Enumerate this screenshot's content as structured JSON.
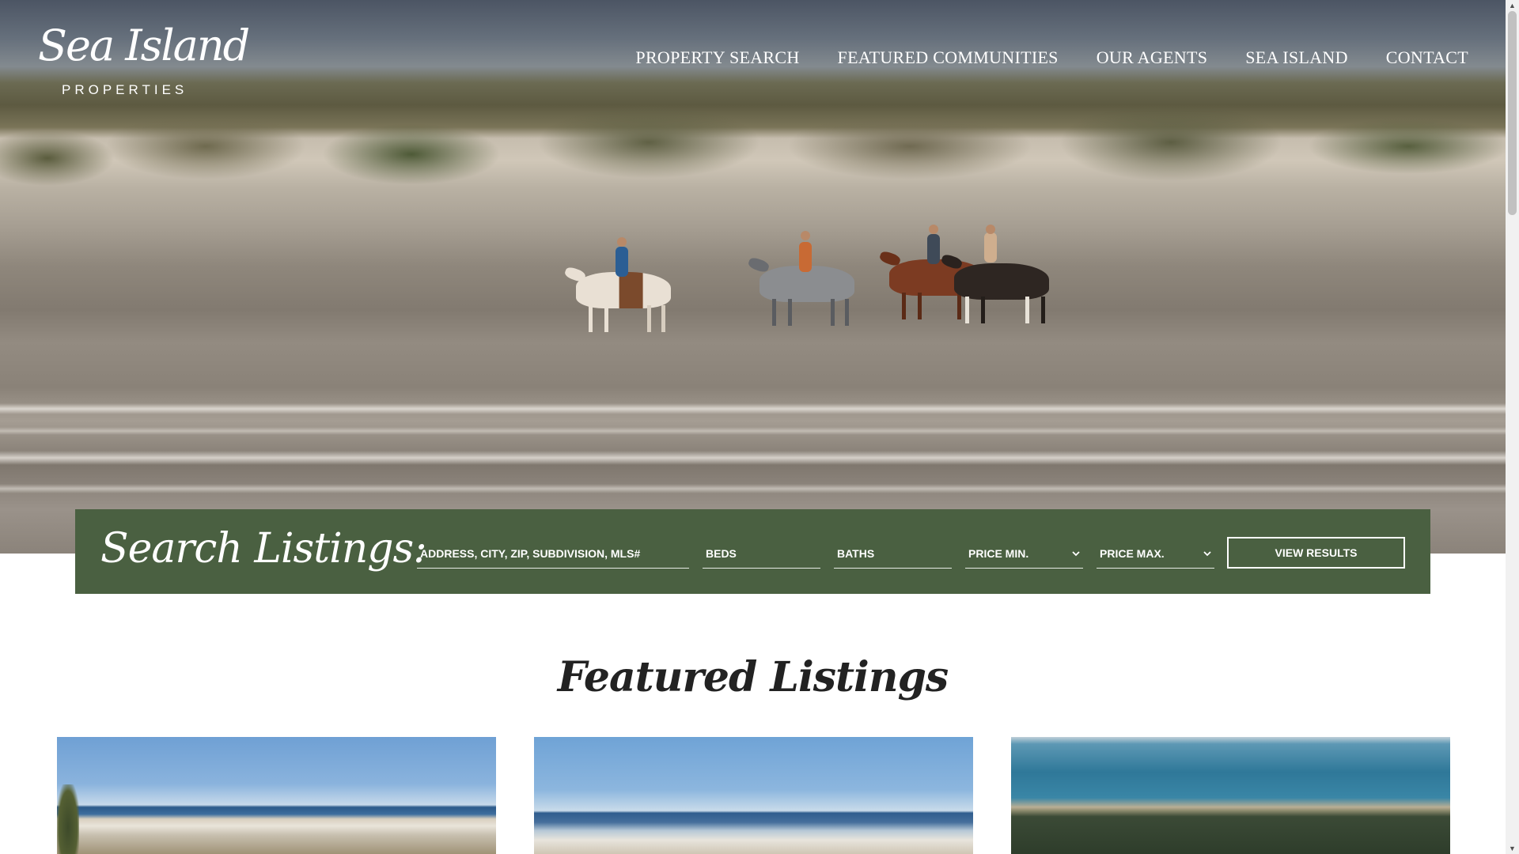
{
  "brand": {
    "logo_script": "Sea Island",
    "logo_sub": "PROPERTIES"
  },
  "nav": {
    "items": [
      {
        "label": "PROPERTY SEARCH"
      },
      {
        "label": "FEATURED COMMUNITIES"
      },
      {
        "label": "OUR AGENTS"
      },
      {
        "label": "SEA ISLAND"
      },
      {
        "label": "CONTACT"
      }
    ]
  },
  "search": {
    "title": "Search Listings:",
    "location_placeholder": "ADDRESS, CITY, ZIP, SUBDIVISION, MLS#",
    "beds_placeholder": "BEDS",
    "baths_placeholder": "BATHS",
    "price_min_label": "PRICE MIN.",
    "price_max_label": "PRICE MAX.",
    "submit_label": "VIEW RESULTS"
  },
  "featured": {
    "title": "Featured Listings"
  },
  "colors": {
    "search_bar": "#4a6041",
    "text_light": "#ffffff",
    "heading_dark": "#222222"
  },
  "icons": {
    "dropdown": "chevron-down-icon",
    "scroll_up": "scroll-up-arrow",
    "scroll_down": "scroll-down-arrow"
  }
}
